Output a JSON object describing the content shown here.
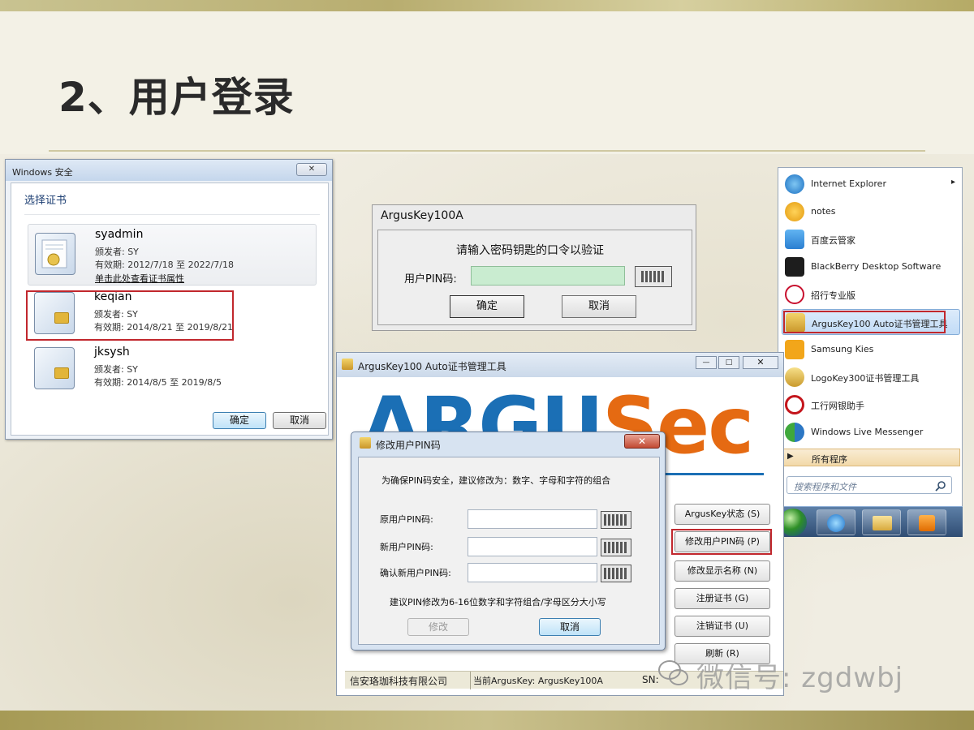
{
  "slide": {
    "title": "2、用户登录"
  },
  "security_dialog": {
    "window_title": "Windows 安全",
    "close_glyph": "✕",
    "heading": "选择证书",
    "certs": [
      {
        "name": "syadmin",
        "issuer": "颁发者: SY",
        "validity": "有效期: 2012/7/18 至 2022/7/18",
        "link": "单击此处查看证书属性"
      },
      {
        "name": "keqian",
        "issuer": "颁发者: SY",
        "validity": "有效期: 2014/8/21 至 2019/8/21"
      },
      {
        "name": "jksysh",
        "issuer": "颁发者: SY",
        "validity": "有效期: 2014/8/5 至 2019/8/5"
      }
    ],
    "ok_label": "确定",
    "cancel_label": "取消",
    "highlight_color": "#c1272d"
  },
  "argus_dialog": {
    "window_title": "ArgusKey100A",
    "prompt": "请输入密码钥匙的口令以验证",
    "pin_label": "用户PIN码:",
    "pin_value": "",
    "ok_label": "确定",
    "cancel_label": "取消"
  },
  "start_menu": {
    "items": [
      {
        "label": "Internet Explorer",
        "icon": "ie-icon",
        "arrow": "▸"
      },
      {
        "label": "notes",
        "icon": "notes-icon"
      },
      {
        "label": "百度云管家",
        "icon": "baidu-cloud-icon"
      },
      {
        "label": "BlackBerry Desktop Software",
        "icon": "blackberry-icon"
      },
      {
        "label": "招行专业版",
        "icon": "cmb-icon"
      },
      {
        "label": "ArgusKey100 Auto证书管理工具",
        "icon": "arguskey-icon"
      },
      {
        "label": "Samsung Kies",
        "icon": "kies-icon"
      },
      {
        "label": "LogoKey300证书管理工具",
        "icon": "logokey-icon"
      },
      {
        "label": "工行网银助手",
        "icon": "icbc-icon"
      },
      {
        "label": "Windows Live Messenger",
        "icon": "messenger-icon"
      }
    ],
    "all_programs": "所有程序",
    "search_placeholder": "搜索程序和文件"
  },
  "manager_window": {
    "window_title": "ArgusKey100 Auto证书管理工具",
    "logo_left": "ARGU",
    "logo_s": "S",
    "logo_right": "ec",
    "buttons": [
      {
        "label": "ArgusKey状态 (S)"
      },
      {
        "label": "修改用户PIN码 (P)"
      },
      {
        "label": "修改显示名称 (N)"
      },
      {
        "label": "注册证书 (G)"
      },
      {
        "label": "注销证书 (U)"
      },
      {
        "label": "刷新 (R)"
      }
    ],
    "status_company": "信安珞珈科技有限公司",
    "status_current": "当前ArgusKey: ArgusKey100A",
    "status_sn": "SN:"
  },
  "pin_dialog": {
    "window_title": "修改用户PIN码",
    "close_glyph": "✕",
    "notice": "为确保PIN码安全，建议修改为：数字、字母和字符的组合",
    "old_pin_label": "原用户PIN码:",
    "new_pin_label": "新用户PIN码:",
    "confirm_pin_label": "确认新用户PIN码:",
    "hint": "建议PIN修改为6-16位数字和字符组合/字母区分大小写",
    "modify_label": "修改",
    "cancel_label": "取消"
  },
  "watermark": {
    "text": "微信号: zgdwbj"
  },
  "colors": {
    "argus_blue": "#1b6fb5",
    "argus_orange": "#e56a12"
  }
}
